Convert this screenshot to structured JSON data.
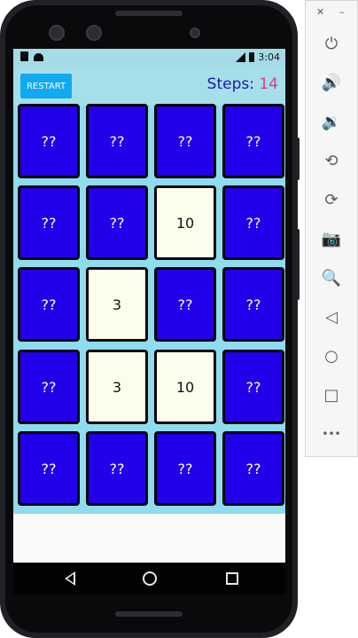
{
  "status_bar": {
    "time": "3:04"
  },
  "app": {
    "restart_label": "RESTART",
    "steps_label": "Steps: ",
    "steps_value": "14"
  },
  "cards": [
    {
      "text": "??",
      "revealed": false
    },
    {
      "text": "??",
      "revealed": false
    },
    {
      "text": "??",
      "revealed": false
    },
    {
      "text": "??",
      "revealed": false
    },
    {
      "text": "??",
      "revealed": false
    },
    {
      "text": "??",
      "revealed": false
    },
    {
      "text": "10",
      "revealed": true
    },
    {
      "text": "??",
      "revealed": false
    },
    {
      "text": "??",
      "revealed": false
    },
    {
      "text": "3",
      "revealed": true
    },
    {
      "text": "??",
      "revealed": false
    },
    {
      "text": "??",
      "revealed": false
    },
    {
      "text": "??",
      "revealed": false
    },
    {
      "text": "3",
      "revealed": true
    },
    {
      "text": "10",
      "revealed": true
    },
    {
      "text": "??",
      "revealed": false
    },
    {
      "text": "??",
      "revealed": false
    },
    {
      "text": "??",
      "revealed": false
    },
    {
      "text": "??",
      "revealed": false
    },
    {
      "text": "??",
      "revealed": false
    }
  ],
  "emulator_toolbar": {
    "close_glyph": "✕",
    "minimize_glyph": "–",
    "items": [
      {
        "name": "power-icon",
        "glyph": "⏻"
      },
      {
        "name": "volume-up-icon",
        "glyph": "🔊"
      },
      {
        "name": "volume-down-icon",
        "glyph": "🔉"
      },
      {
        "name": "rotate-left-icon",
        "glyph": "⟲"
      },
      {
        "name": "rotate-right-icon",
        "glyph": "⟳"
      },
      {
        "name": "camera-icon",
        "glyph": "📷"
      },
      {
        "name": "zoom-icon",
        "glyph": "🔍"
      },
      {
        "name": "back-icon",
        "glyph": "◁"
      },
      {
        "name": "home-icon",
        "glyph": "○"
      },
      {
        "name": "overview-icon",
        "glyph": "□"
      },
      {
        "name": "more-icon",
        "glyph": "•••"
      }
    ]
  },
  "colors": {
    "card_hidden": "#2200ea",
    "card_revealed": "#fdfdec",
    "grid_background": "#8edcee",
    "restart_button": "#11a9f0",
    "steps_label": "#1a1aa0",
    "steps_value": "#e23686"
  }
}
